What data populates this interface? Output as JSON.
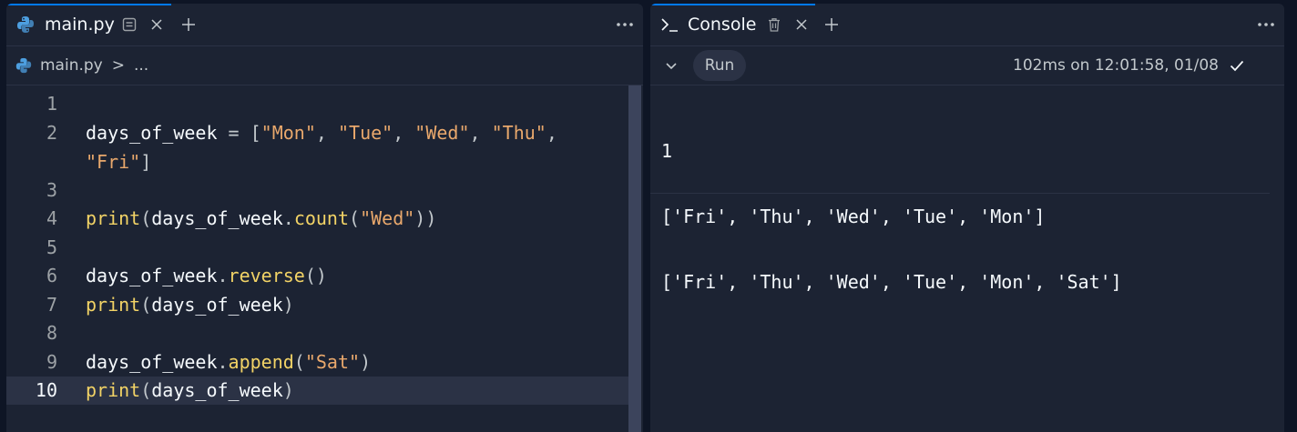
{
  "editor": {
    "tab": {
      "filename": "main.py",
      "file_icon": "python-icon",
      "options_icon": "file-options-icon",
      "close_icon": "close-icon"
    },
    "add_tab_icon": "plus-icon",
    "more_icon": "ellipsis-icon",
    "breadcrumb": {
      "file": "main.py",
      "separator": ">",
      "more": "..."
    },
    "line_numbers": [
      "1",
      "2",
      "3",
      "4",
      "5",
      "6",
      "7",
      "8",
      "9",
      "10"
    ],
    "current_line": "10",
    "code": {
      "l2_var": "days_of_week",
      "l2_op": " = [",
      "s_mon": "\"Mon\"",
      "s_tue": "\"Tue\"",
      "s_wed": "\"Wed\"",
      "s_thu": "\"Thu\"",
      "s_fri": "\"Fri\"",
      "comma": ", ",
      "comma_end": ",",
      "close_bracket": "]",
      "print": "print",
      "open": "(",
      "close": ")",
      "close2": "))",
      "dow": "days_of_week",
      "dot": ".",
      "count": "count",
      "reverse": "reverse",
      "append": "append",
      "s_wed2": "\"Wed\"",
      "s_sat": "\"Sat\"",
      "empty_parens": "()"
    }
  },
  "console": {
    "tab_label": "Console",
    "tab_icon": "terminal-icon",
    "trash_icon": "trash-icon",
    "close_icon": "close-icon",
    "add_icon": "plus-icon",
    "more_icon": "ellipsis-icon",
    "chevron_icon": "chevron-down-icon",
    "run_label": "Run",
    "status": "102ms on 12:01:58, 01/08",
    "status_icon": "check-icon",
    "output": [
      "1",
      "['Fri', 'Thu', 'Wed', 'Tue', 'Mon']",
      "['Fri', 'Thu', 'Wed', 'Tue', 'Mon', 'Sat']"
    ]
  },
  "colors": {
    "accent": "#0079f2",
    "string": "#e9a86c",
    "function": "#f2d366",
    "background": "#1c2333"
  }
}
